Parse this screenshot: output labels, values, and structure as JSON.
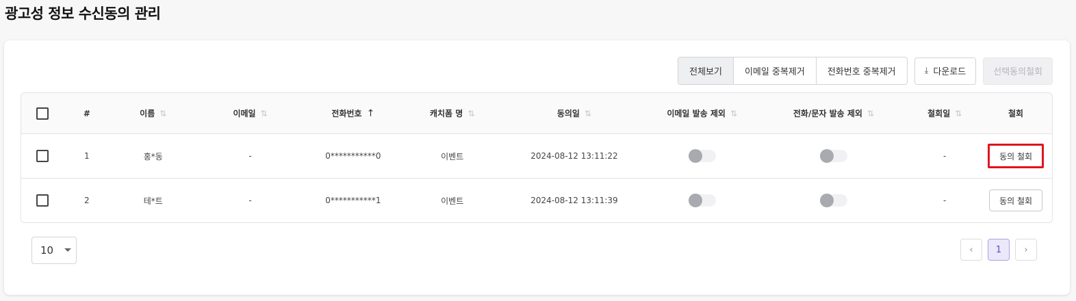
{
  "page": {
    "title": "광고성 정보 수신동의 관리"
  },
  "toolbar": {
    "filters": [
      "전체보기",
      "이메일 중복제거",
      "전화번호 중복제거"
    ],
    "download_label": "다운로드",
    "withdraw_selected_label": "선택동의철회"
  },
  "table": {
    "columns": [
      "#",
      "이름",
      "이메일",
      "전화번호",
      "캐치폼 명",
      "동의일",
      "이메일 발송 제외",
      "전화/문자 발송 제외",
      "철회일",
      "철회"
    ],
    "rows": [
      {
        "no": "1",
        "name": "홍*동",
        "email": "-",
        "phone": "0***********0",
        "form": "이벤트",
        "agreed_at": "2024-08-12 13:11:22",
        "email_exclude": false,
        "phone_exclude": false,
        "withdrawn_at": "-",
        "action": "동의 철회"
      },
      {
        "no": "2",
        "name": "테*트",
        "email": "-",
        "phone": "0***********1",
        "form": "이벤트",
        "agreed_at": "2024-08-12 13:11:39",
        "email_exclude": false,
        "phone_exclude": false,
        "withdrawn_at": "-",
        "action": "동의 철회"
      }
    ],
    "sort": {
      "column": "전화번호",
      "direction": "asc"
    }
  },
  "pagination": {
    "page_size": "10",
    "current_page": "1"
  },
  "icons": {
    "download": "download-icon",
    "sort": "sort-icon",
    "prev": "chevron-left-icon",
    "next": "chevron-right-icon",
    "dropdown": "caret-down-icon"
  },
  "colors": {
    "highlight": "#e0141e",
    "current_page_bg": "#ebe8fb",
    "current_page_text": "#5a4fc4"
  }
}
